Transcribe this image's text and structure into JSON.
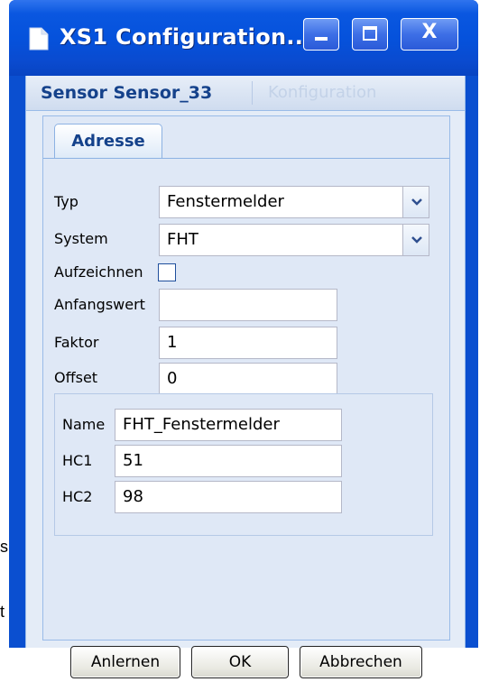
{
  "window": {
    "title": "XS1 Configuration...",
    "close_glyph": "X"
  },
  "background": {
    "fragment_1": "s",
    "fragment_2": "t"
  },
  "panel": {
    "title": "Sensor Sensor_33",
    "secondary_tab": "Konfiguration"
  },
  "tabs": [
    {
      "label": "Adresse",
      "active": true
    }
  ],
  "form": {
    "typ": {
      "label": "Typ",
      "value": "Fenstermelder"
    },
    "system": {
      "label": "System",
      "value": "FHT"
    },
    "aufzeichnen": {
      "label": "Aufzeichnen",
      "checked": false
    },
    "anfangswert": {
      "label": "Anfangswert",
      "value": ""
    },
    "faktor": {
      "label": "Faktor",
      "value": "1"
    },
    "offset": {
      "label": "Offset",
      "value": "0"
    }
  },
  "fht_group": {
    "name": {
      "label": "Name",
      "value": "FHT_Fenstermelder"
    },
    "hc1": {
      "label": "HC1",
      "value": "51"
    },
    "hc2": {
      "label": "HC2",
      "value": "98"
    }
  },
  "buttons": {
    "anlernen": "Anlernen",
    "ok": "OK",
    "abbrechen": "Abbrechen"
  },
  "colors": {
    "titlebar": "#0552dc",
    "panel_title": "#15428b",
    "panel_bg": "#dfe8f6"
  },
  "icons": {
    "title": "document-icon",
    "minimize": "minimize-icon",
    "maximize": "maximize-icon",
    "close": "close-icon",
    "combo": "chevron-down-icon"
  }
}
